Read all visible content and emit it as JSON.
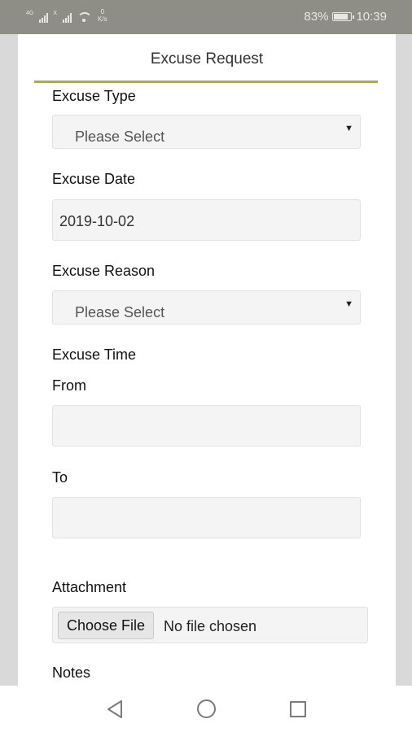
{
  "status_bar": {
    "network_tag_1": "4G",
    "network_tag_2": "X",
    "speed_value": "0",
    "speed_unit": "K/s",
    "battery": "83%",
    "time": "10:39"
  },
  "header": {
    "title": "Excuse Request"
  },
  "form": {
    "excuse_type": {
      "label": "Excuse Type",
      "value": "Please Select"
    },
    "excuse_date": {
      "label": "Excuse Date",
      "value": "2019-10-02"
    },
    "excuse_reason": {
      "label": "Excuse Reason",
      "value": "Please Select"
    },
    "excuse_time": {
      "label": "Excuse Time",
      "from_label": "From",
      "from_value": "",
      "to_label": "To",
      "to_value": ""
    },
    "attachment": {
      "label": "Attachment",
      "button": "Choose File",
      "status": "No file chosen"
    },
    "notes": {
      "label": "Notes"
    }
  },
  "colors": {
    "accent_line": "#b0ad2f",
    "status_bar": "#8e8e86"
  },
  "icons": {
    "dropdown": "caret-down-icon",
    "nav_back": "triangle-back-icon",
    "nav_home": "circle-home-icon",
    "nav_recent": "square-recent-icon"
  }
}
